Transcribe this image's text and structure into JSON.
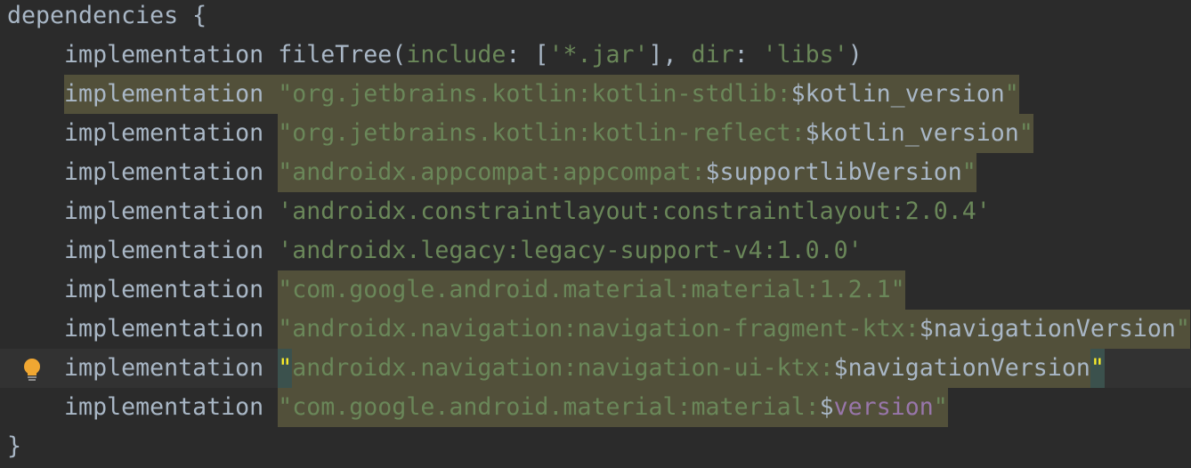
{
  "editor": {
    "lines": [
      {
        "tokens": [
          {
            "t": "dependencies {",
            "k": "p"
          }
        ]
      },
      {
        "tokens": [
          {
            "t": "    implementation fileTree(",
            "k": "p"
          },
          {
            "t": "include",
            "k": "s"
          },
          {
            "t": ": [",
            "k": "p"
          },
          {
            "t": "'*.jar'",
            "k": "s"
          },
          {
            "t": "], ",
            "k": "p"
          },
          {
            "t": "dir",
            "k": "s"
          },
          {
            "t": ": ",
            "k": "p"
          },
          {
            "t": "'libs'",
            "k": "s"
          },
          {
            "t": ")",
            "k": "p"
          }
        ]
      },
      {
        "tokens": [
          {
            "t": "    ",
            "k": "p"
          },
          {
            "t": "implementation ",
            "k": "p",
            "h": true
          },
          {
            "t": "\"org.jetbrains.kotlin:kotlin-stdlib:",
            "k": "s",
            "h": true
          },
          {
            "t": "$kotlin_version",
            "k": "p",
            "h": true
          },
          {
            "t": "\"",
            "k": "s",
            "h": true
          }
        ]
      },
      {
        "tokens": [
          {
            "t": "    implementation ",
            "k": "p"
          },
          {
            "t": "\"org.jetbrains.kotlin:kotlin-reflect:",
            "k": "s",
            "h": true
          },
          {
            "t": "$kotlin_version",
            "k": "p",
            "h": true
          },
          {
            "t": "\"",
            "k": "s",
            "h": true
          }
        ]
      },
      {
        "tokens": [
          {
            "t": "    implementation ",
            "k": "p"
          },
          {
            "t": "\"androidx.appcompat:appcompat:",
            "k": "s",
            "h": true
          },
          {
            "t": "$supportlibVersion",
            "k": "p",
            "h": true
          },
          {
            "t": "\"",
            "k": "s",
            "h": true
          }
        ]
      },
      {
        "tokens": [
          {
            "t": "    implementation ",
            "k": "p"
          },
          {
            "t": "'androidx.constraintlayout:constraintlayout:2.0.4'",
            "k": "s"
          }
        ]
      },
      {
        "tokens": [
          {
            "t": "    implementation ",
            "k": "p"
          },
          {
            "t": "'androidx.legacy:legacy-support-v4:1.0.0'",
            "k": "s"
          }
        ]
      },
      {
        "tokens": [
          {
            "t": "    implementation ",
            "k": "p"
          },
          {
            "t": "\"com.google.android.material:material:1.2.1\"",
            "k": "s",
            "h": true
          }
        ]
      },
      {
        "tokens": [
          {
            "t": "    implementation ",
            "k": "p"
          },
          {
            "t": "\"androidx.navigation:navigation-fragment-ktx:",
            "k": "s",
            "h": true
          },
          {
            "t": "$navigationVersion",
            "k": "p",
            "h": true
          },
          {
            "t": "\"",
            "k": "s",
            "h": true
          }
        ]
      },
      {
        "current": true,
        "icon": "lightbulb-icon",
        "tokens": [
          {
            "t": "    implementation ",
            "k": "p"
          },
          {
            "t": "\"",
            "k": "m"
          },
          {
            "t": "androidx.navigation:navigation-ui-ktx:",
            "k": "s",
            "h": true
          },
          {
            "t": "$navigationVersion",
            "k": "p",
            "h": true
          },
          {
            "t": "\"",
            "k": "m"
          }
        ]
      },
      {
        "tokens": [
          {
            "t": "    implementation ",
            "k": "p"
          },
          {
            "t": "\"com.google.android.material:material:",
            "k": "s",
            "h": true
          },
          {
            "t": "$",
            "k": "p",
            "h": true
          },
          {
            "t": "version",
            "k": "v",
            "h": true
          },
          {
            "t": "\"",
            "k": "s",
            "h": true
          }
        ]
      },
      {
        "tokens": [
          {
            "t": "}",
            "k": "p"
          }
        ]
      }
    ]
  },
  "colors": {
    "background": "#2b2b2b",
    "text": "#a9b7c6",
    "string": "#6a8759",
    "variable": "#9876aa",
    "highlight": "#52503a",
    "bracket_match": "#3b514d"
  }
}
